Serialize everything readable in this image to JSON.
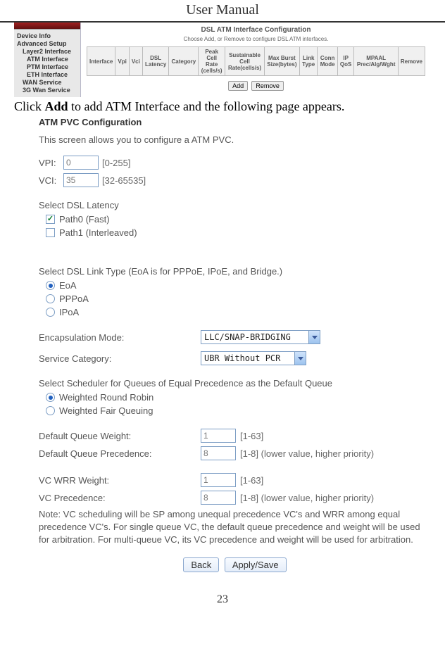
{
  "header": {
    "title": "User Manual"
  },
  "topConfig": {
    "sidebar": {
      "root": "Device Info",
      "setup": "Advanced Setup",
      "items": [
        "Layer2 Interface",
        "ATM Interface",
        "PTM Interface",
        "ETH Interface",
        "WAN Service",
        "3G Wan Service"
      ]
    },
    "title": "DSL ATM Interface Configuration",
    "subtitle": "Choose Add, or Remove to configure DSL ATM interfaces.",
    "headers": [
      "Interface",
      "Vpi",
      "Vci",
      "DSL Latency",
      "Category",
      "Peak Cell Rate (cells/s)",
      "Sustainable Cell Rate(cells/s)",
      "Max Burst Size(bytes)",
      "Link Type",
      "Conn Mode",
      "IP QoS",
      "MPAAL Prec/Alg/Wght",
      "Remove"
    ],
    "buttons": {
      "add": "Add",
      "remove": "Remove"
    }
  },
  "instruction": {
    "pre": "Click",
    "bold": "Add",
    "post": "to add ATM Interface and the following page appears."
  },
  "config": {
    "title": "ATM PVC Configuration",
    "intro": "This screen allows you to configure a ATM PVC.",
    "vpi": {
      "label": "VPI:",
      "value": "0",
      "hint": "[0-255]"
    },
    "vci": {
      "label": "VCI:",
      "value": "35",
      "hint": "[32-65535]"
    },
    "latency": {
      "label": "Select DSL Latency",
      "path0": "Path0 (Fast)",
      "path1": "Path1 (Interleaved)"
    },
    "linkType": {
      "label": "Select DSL Link Type (EoA is for PPPoE, IPoE, and Bridge.)",
      "options": [
        "EoA",
        "PPPoA",
        "IPoA"
      ]
    },
    "encap": {
      "label": "Encapsulation Mode:",
      "value": "LLC/SNAP-BRIDGING"
    },
    "service": {
      "label": "Service Category:",
      "value": "UBR Without PCR"
    },
    "scheduler": {
      "label": "Select Scheduler for Queues of Equal Precedence as the Default Queue",
      "options": [
        "Weighted Round Robin",
        "Weighted Fair Queuing"
      ]
    },
    "weights": {
      "qweight": {
        "label": "Default Queue Weight:",
        "value": "1",
        "hint": "[1-63]"
      },
      "qprec": {
        "label": "Default Queue Precedence:",
        "value": "8",
        "hint": "[1-8] (lower value, higher priority)"
      },
      "vcwrr": {
        "label": "VC WRR Weight:",
        "value": "1",
        "hint": "[1-63]"
      },
      "vcprec": {
        "label": "VC Precedence:",
        "value": "8",
        "hint": "[1-8] (lower value, higher priority)"
      }
    },
    "note": "Note: VC scheduling will be SP among unequal precedence VC's and WRR among equal precedence VC's. For single queue VC, the default queue precedence and weight will be used for arbitration. For multi-queue VC, its VC precedence and weight will be used for arbitration.",
    "buttons": {
      "back": "Back",
      "apply": "Apply/Save"
    }
  },
  "footer": {
    "page": "23"
  }
}
